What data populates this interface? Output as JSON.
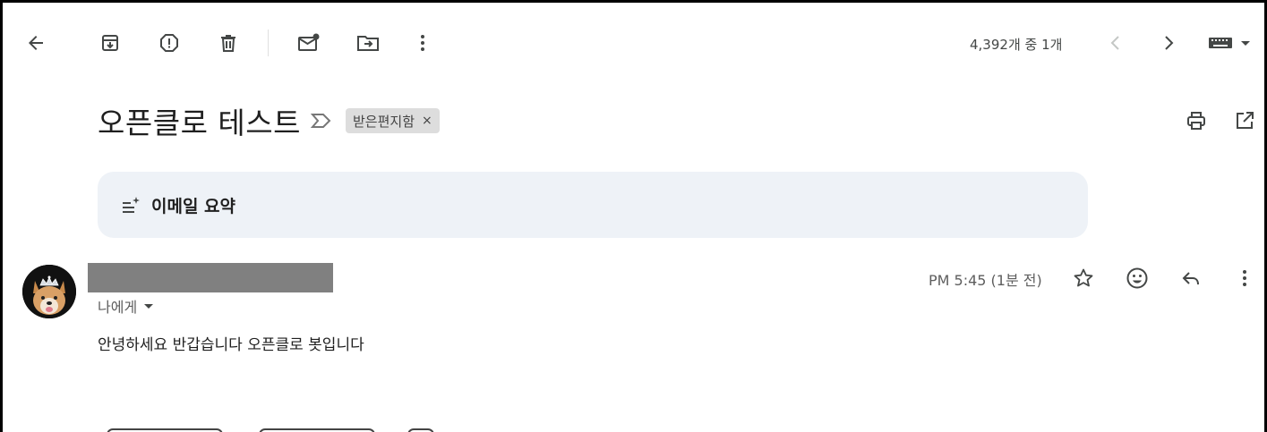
{
  "toolbar": {
    "back_icon": "arrow-left-icon",
    "archive_icon": "archive-icon",
    "report_spam_icon": "report-icon",
    "delete_icon": "trash-icon",
    "mark_unread_icon": "mark-unread-icon",
    "move_to_icon": "move-to-folder-icon",
    "more_icon": "more-vert-icon"
  },
  "pager": {
    "text": "4,392개 중 1개",
    "prev_icon": "chevron-left-icon",
    "next_icon": "chevron-right-icon",
    "keyboard_icon": "keyboard-icon"
  },
  "message": {
    "subject": "오픈클로 테스트",
    "label": "받은편지함",
    "label_remove": "×",
    "summary_label": "이메일 요약",
    "to_line": "나에게",
    "time": "PM 5:45 (1분 전)",
    "body": "안녕하세요 반갑습니다 오픈클로 봇입니다"
  },
  "colors": {
    "summary_bg": "#eef2f7",
    "chip_bg": "#dddddd",
    "redaction": "#808080",
    "icon": "#444746"
  }
}
